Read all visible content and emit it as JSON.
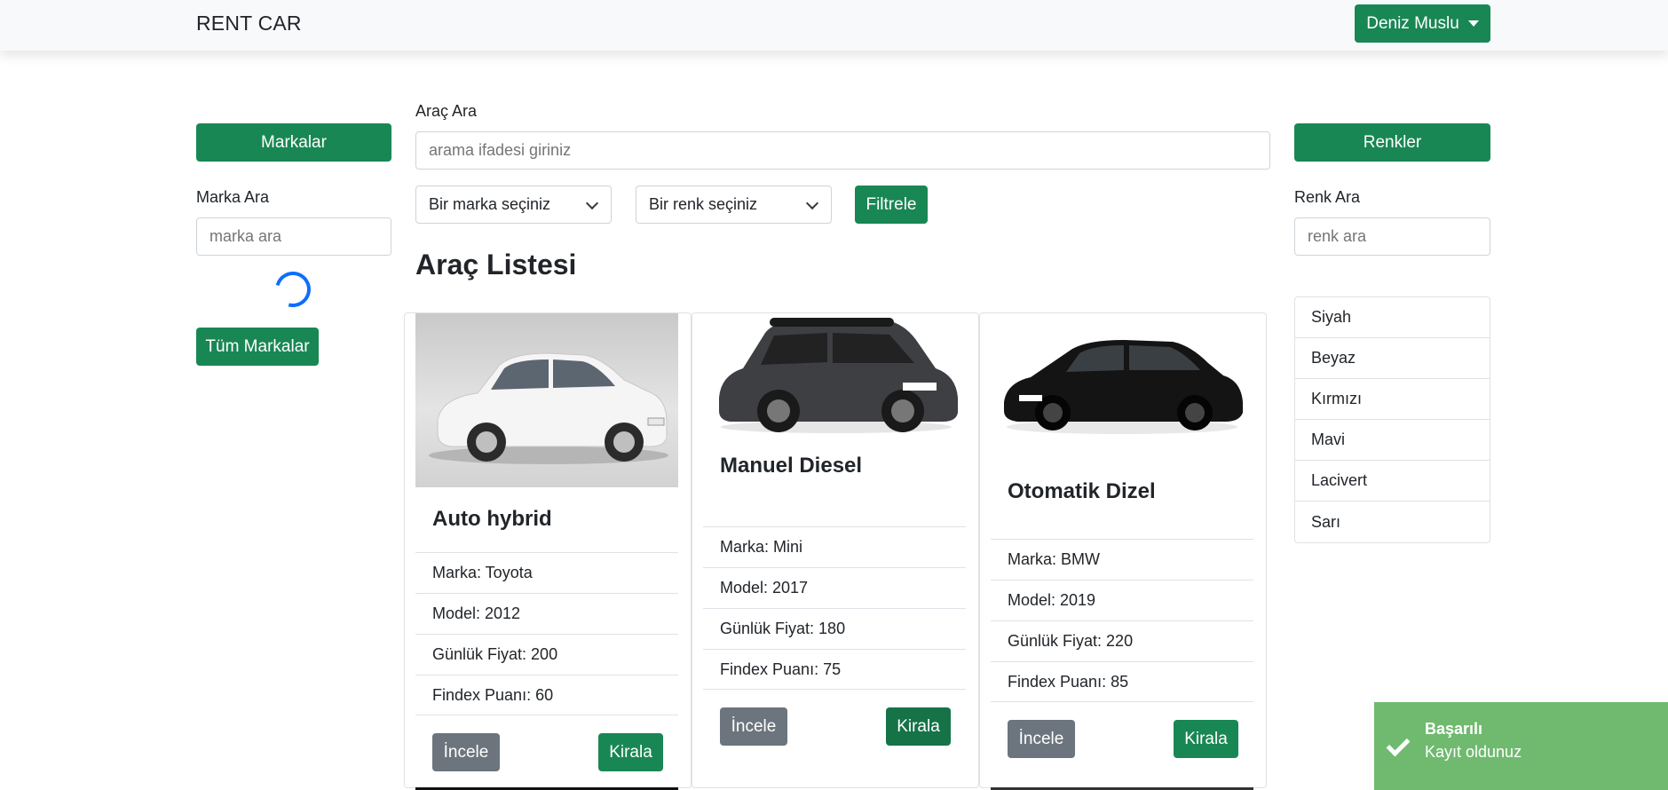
{
  "navbar": {
    "brand": "RENT CAR",
    "user_label": "Deniz Muslu"
  },
  "left": {
    "brands_button": "Markalar",
    "search_label": "Marka Ara",
    "search_placeholder": "marka ara",
    "all_brands_button": "Tüm Markalar"
  },
  "center": {
    "search_label": "Araç Ara",
    "search_placeholder": "arama ifadesi giriniz",
    "brand_select": "Bir marka seçiniz",
    "color_select": "Bir renk seçiniz",
    "filter_button": "Filtrele",
    "heading": "Araç Listesi"
  },
  "cars": [
    {
      "title": "Auto hybrid",
      "brand": "Marka: Toyota",
      "model": "Model: 2012",
      "price": "Günlük Fiyat: 200",
      "findex": "Findex Puanı: 60",
      "inspect": "İncele",
      "rent": "Kirala",
      "image_icon": "white-sedan-image"
    },
    {
      "title": "Manuel Diesel",
      "brand": "Marka: Mini",
      "model": "Model: 2017",
      "price": "Günlük Fiyat: 180",
      "findex": "Findex Puanı: 75",
      "inspect": "İncele",
      "rent": "Kirala",
      "image_icon": "dark-mini-image"
    },
    {
      "title": "Otomatik Dizel",
      "brand": "Marka: BMW",
      "model": "Model: 2019",
      "price": "Günlük Fiyat: 220",
      "findex": "Findex Puanı: 85",
      "inspect": "İncele",
      "rent": "Kirala",
      "image_icon": "black-bmw-image"
    }
  ],
  "right": {
    "colors_button": "Renkler",
    "search_label": "Renk Ara",
    "search_placeholder": "renk ara",
    "colors": [
      "Siyah",
      "Beyaz",
      "Kırmızı",
      "Mavi",
      "Lacivert",
      "Sarı"
    ]
  },
  "toast": {
    "title": "Başarılı",
    "message": "Kayıt oldunuz"
  },
  "theme": {
    "primary": "#198754",
    "secondary": "#6c757d",
    "spinner": "#0d6efd",
    "toast": "#6fba6f"
  }
}
